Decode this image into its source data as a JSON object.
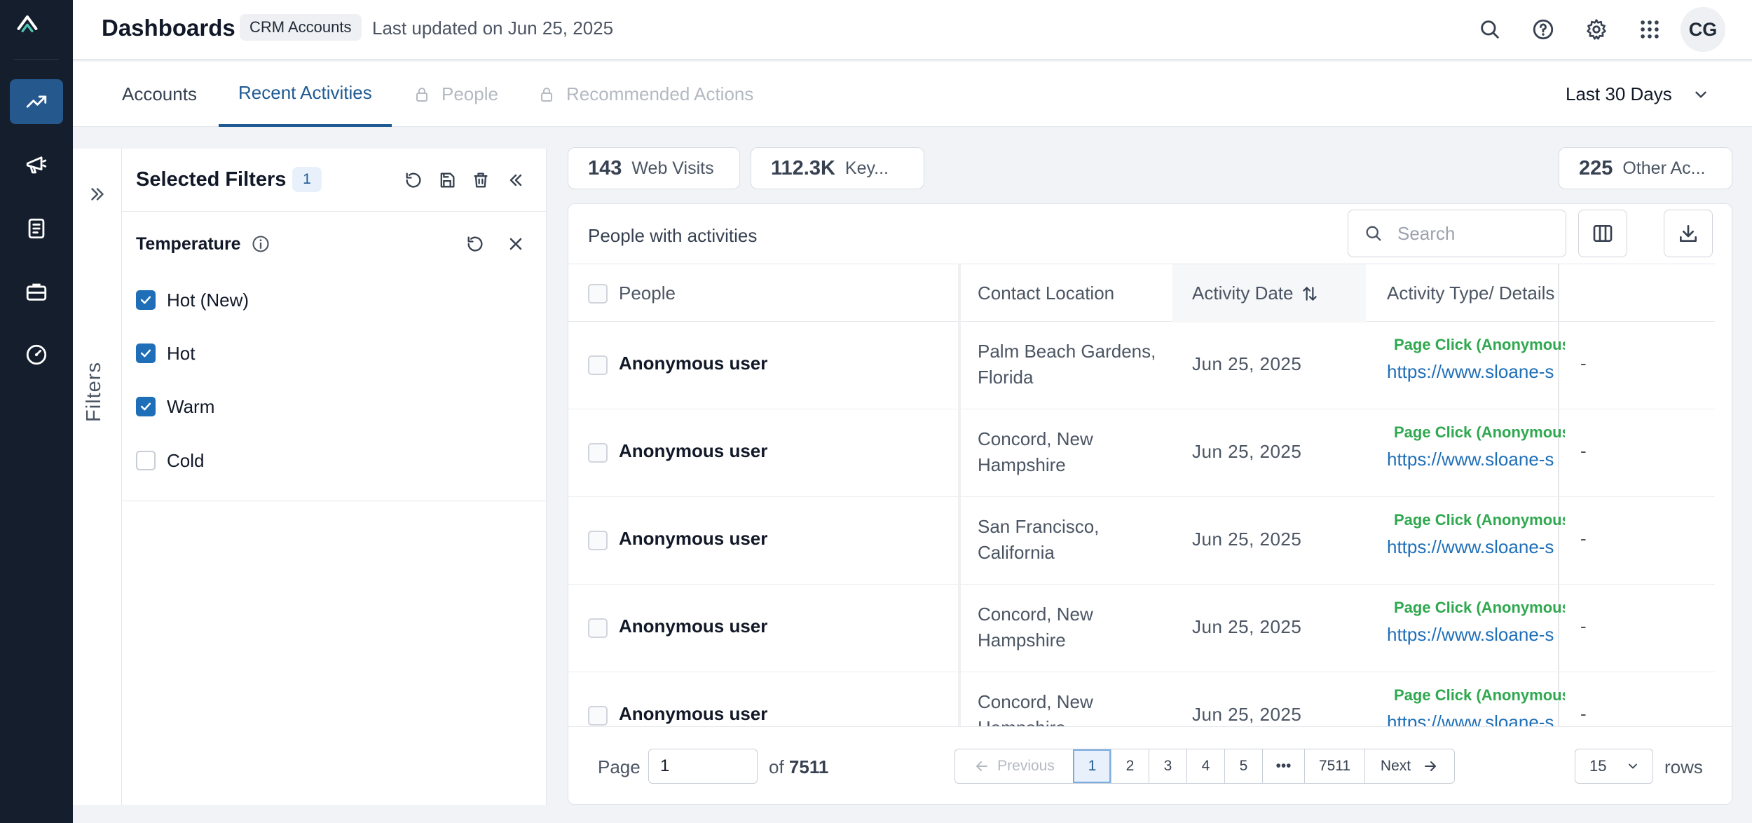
{
  "rail": {
    "items": [
      {
        "icon": "trending-up-icon",
        "active": true
      },
      {
        "icon": "megaphone-icon",
        "active": false
      },
      {
        "icon": "document-icon",
        "active": false
      },
      {
        "icon": "briefcase-icon",
        "active": false
      },
      {
        "icon": "gauge-icon",
        "active": false
      }
    ]
  },
  "header": {
    "title": "Dashboards",
    "badge": "CRM Accounts",
    "last_updated": "Last updated on Jun 25, 2025",
    "avatar_initials": "CG"
  },
  "tabs": [
    {
      "label": "Accounts",
      "state": "normal"
    },
    {
      "label": "Recent Activities",
      "state": "active"
    },
    {
      "label": "People",
      "state": "locked"
    },
    {
      "label": "Recommended Actions",
      "state": "locked"
    }
  ],
  "date_range": "Last 30 Days",
  "filters_strip": {
    "label": "Filters"
  },
  "filter_panel": {
    "title": "Selected Filters",
    "count": "1",
    "group": {
      "label": "Temperature",
      "options": [
        {
          "label": "Hot (New)",
          "checked": true
        },
        {
          "label": "Hot",
          "checked": true
        },
        {
          "label": "Warm",
          "checked": true
        },
        {
          "label": "Cold",
          "checked": false
        }
      ]
    }
  },
  "metrics": [
    {
      "value": "143",
      "label": "Web Visits"
    },
    {
      "value": "112.3K",
      "label": "Key..."
    },
    {
      "value": "225",
      "label": "Other Ac..."
    }
  ],
  "table": {
    "title": "People with activities",
    "search_placeholder": "Search",
    "columns": {
      "people": "People",
      "location": "Contact Location",
      "date": "Activity Date",
      "activity": "Activity Type/ Details"
    },
    "rows": [
      {
        "person": "Anonymous user",
        "location": "Palm Beach Gardens, Florida",
        "date": "Jun 25, 2025",
        "activity_type": "Page Click (Anonymous)",
        "url": "https://www.sloane-s",
        "extra": "-"
      },
      {
        "person": "Anonymous user",
        "location": "Concord, New Hampshire",
        "date": "Jun 25, 2025",
        "activity_type": "Page Click (Anonymous)",
        "url": "https://www.sloane-s",
        "extra": "-"
      },
      {
        "person": "Anonymous user",
        "location": "San Francisco, California",
        "date": "Jun 25, 2025",
        "activity_type": "Page Click (Anonymous)",
        "url": "https://www.sloane-s",
        "extra": "-"
      },
      {
        "person": "Anonymous user",
        "location": "Concord, New Hampshire",
        "date": "Jun 25, 2025",
        "activity_type": "Page Click (Anonymous)",
        "url": "https://www.sloane-s",
        "extra": "-"
      },
      {
        "person": "Anonymous user",
        "location": "Concord, New Hampshire",
        "date": "Jun 25, 2025",
        "activity_type": "Page Click (Anonymous)",
        "url": "https://www.sloane-s",
        "extra": "-"
      }
    ]
  },
  "pagination": {
    "page_label": "Page",
    "current_page": "1",
    "of_label": "of",
    "total_pages": "7511",
    "previous": "Previous",
    "next": "Next",
    "pages": [
      "1",
      "2",
      "3",
      "4",
      "5",
      "•••",
      "7511"
    ],
    "rows_per_page": "15",
    "rows_label": "rows"
  },
  "colors": {
    "rail_bg": "#141e2d",
    "rail_active": "#25598e",
    "accent": "#1f5a92",
    "checkbox": "#1f6fb8",
    "activity_green": "#2fa84f",
    "link": "#1f6fb8"
  }
}
